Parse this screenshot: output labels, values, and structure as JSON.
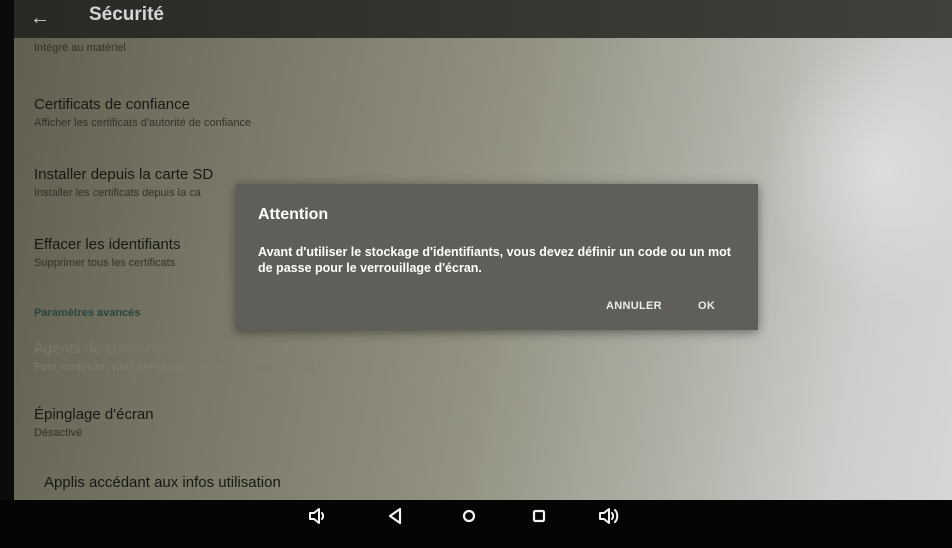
{
  "topbar": {
    "title": "Sécurité",
    "back_icon": "arrow-left-icon"
  },
  "list": {
    "partial_top": "Intégré au matériel",
    "items": [
      {
        "title": "Certificats de confiance",
        "subtitle": "Afficher les certificats d'autorité de confiance"
      },
      {
        "title": "Installer depuis la carte SD",
        "subtitle": "Installer les certificats depuis la ca"
      },
      {
        "title": "Effacer les identifiants",
        "subtitle": "Supprimer tous les certificats"
      }
    ],
    "section_header": "Paramètres avancés",
    "advanced": [
      {
        "title": "Agents de confiance",
        "subtitle": "Pour continuer, vous devez tout d'abord verrouiller l'écran",
        "disabled": true
      },
      {
        "title": "Épinglage d'écran",
        "subtitle": "Désactivé"
      },
      {
        "title": "Applis accédant aux infos utilisation"
      }
    ]
  },
  "dialog": {
    "title": "Attention",
    "message": "Avant d'utiliser le stockage d'identifiants, vous devez définir un code ou un mot de passe pour le verrouillage d'écran.",
    "cancel_label": "ANNULER",
    "ok_label": "OK"
  },
  "navbar": {
    "icons": [
      "volume-down-icon",
      "back-triangle-icon",
      "home-circle-icon",
      "recents-square-icon",
      "volume-up-icon"
    ]
  }
}
